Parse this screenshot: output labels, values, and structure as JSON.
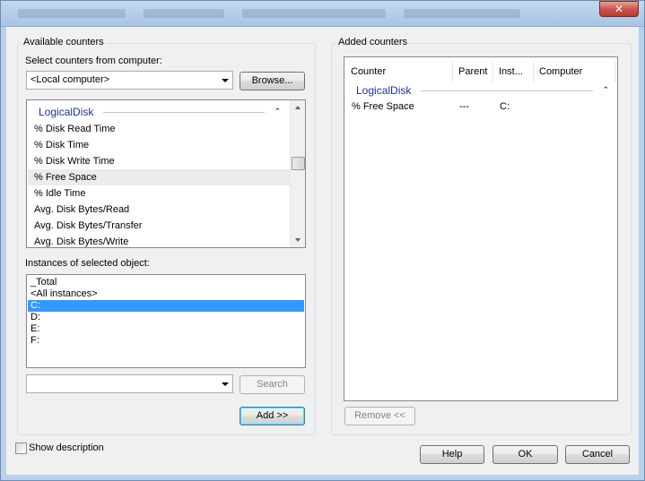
{
  "window": {
    "close_glyph": "✕"
  },
  "available": {
    "group_label": "Available counters",
    "select_label": "Select counters from computer:",
    "computer_value": "<Local computer>",
    "browse_label": "Browse...",
    "object_name": "LogicalDisk",
    "object_chevron": "⌃",
    "counters": [
      "% Disk Read Time",
      "% Disk Time",
      "% Disk Write Time",
      "% Free Space",
      "% Idle Time",
      "Avg. Disk Bytes/Read",
      "Avg. Disk Bytes/Transfer",
      "Avg. Disk Bytes/Write"
    ],
    "selected_counter_index": 3
  },
  "instances": {
    "label": "Instances of selected object:",
    "items": [
      "_Total",
      "<All instances>",
      "C:",
      "D:",
      "E:",
      "F:"
    ],
    "selected_index": 2
  },
  "search": {
    "value": "",
    "button_label": "Search"
  },
  "add_label": "Add >>",
  "added": {
    "group_label": "Added counters",
    "columns": [
      "Counter",
      "Parent",
      "Inst...",
      "Computer"
    ],
    "object_name": "LogicalDisk",
    "object_chevron": "⌃",
    "rows": [
      {
        "counter": "% Free Space",
        "parent": "---",
        "instance": "C:",
        "computer": ""
      }
    ],
    "remove_label": "Remove <<"
  },
  "show_description": {
    "label": "Show description",
    "checked": false
  },
  "footer": {
    "help_label": "Help",
    "ok_label": "OK",
    "cancel_label": "Cancel"
  }
}
